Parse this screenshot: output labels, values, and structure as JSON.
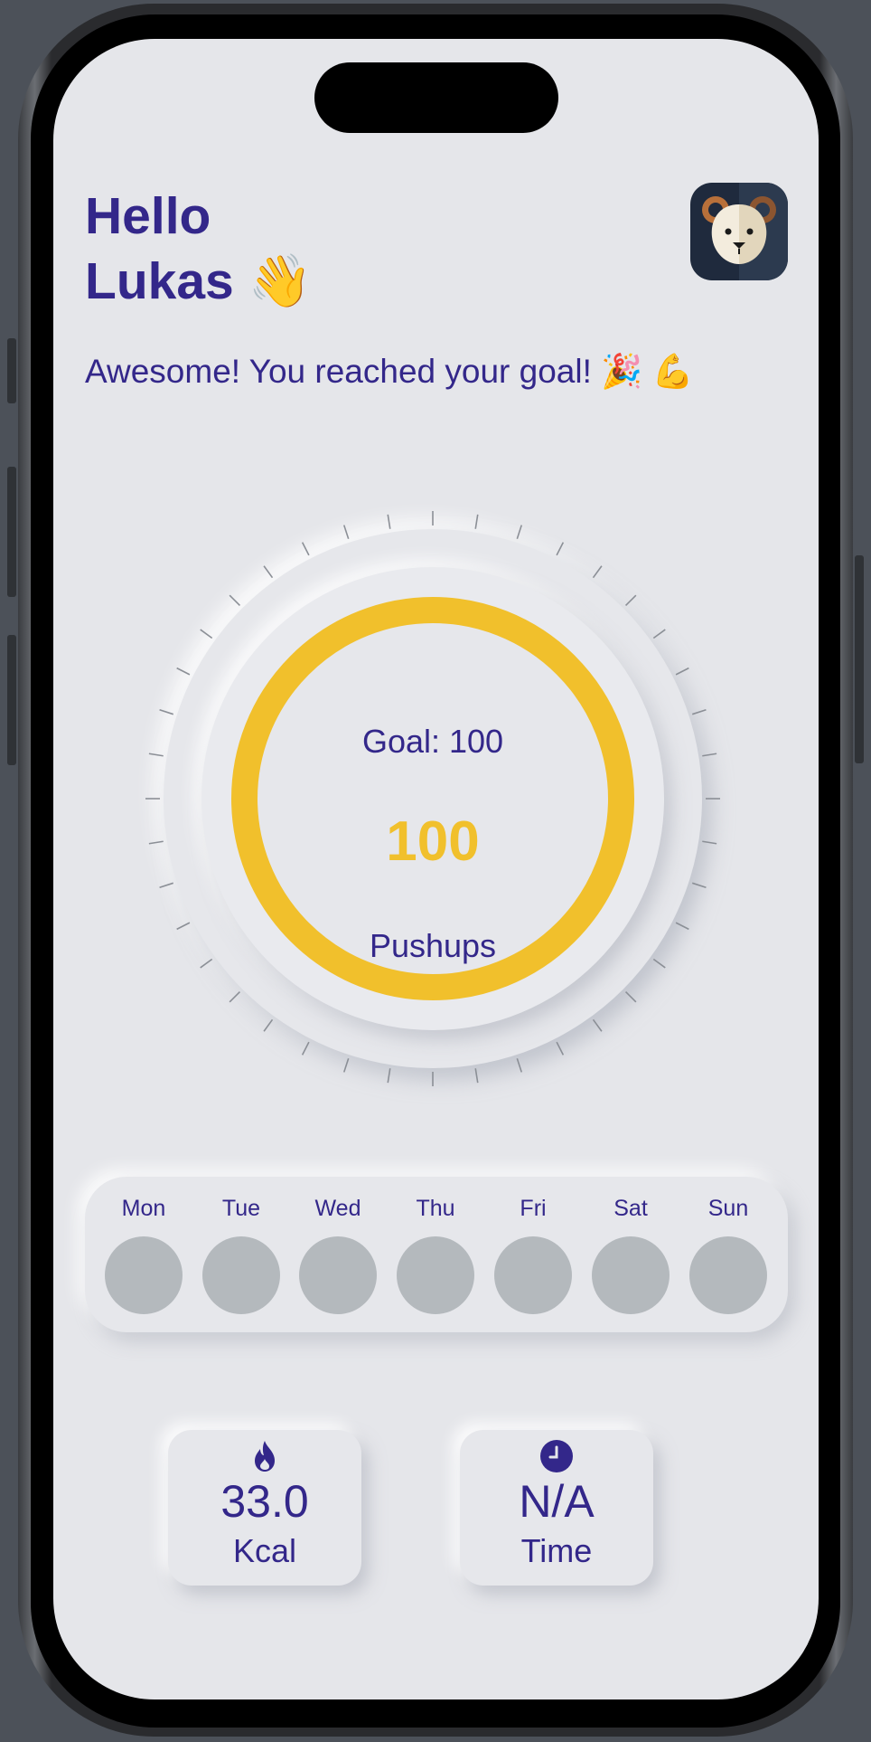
{
  "greeting": {
    "line1": "Hello",
    "line2": "Lukas 👋"
  },
  "subtitle": "Awesome! You reached your goal! 🎉 💪",
  "avatar": {
    "icon": "bear-avatar-icon"
  },
  "progress": {
    "goal_label": "Goal: 100",
    "count": "100",
    "unit": "Pushups",
    "fraction": 1.0,
    "color": "#f1c02c"
  },
  "week": {
    "days": [
      {
        "label": "Mon"
      },
      {
        "label": "Tue"
      },
      {
        "label": "Wed"
      },
      {
        "label": "Thu"
      },
      {
        "label": "Fri"
      },
      {
        "label": "Sat"
      },
      {
        "label": "Sun"
      }
    ]
  },
  "stats": [
    {
      "icon": "flame-icon",
      "value": "33.0",
      "label": "Kcal"
    },
    {
      "icon": "clock-icon",
      "value": "N/A",
      "label": "Time"
    }
  ],
  "colors": {
    "primary": "#33278a",
    "accent": "#f1c02c",
    "background": "#e5e6ea",
    "inactive_day": "#b4b9bd"
  }
}
